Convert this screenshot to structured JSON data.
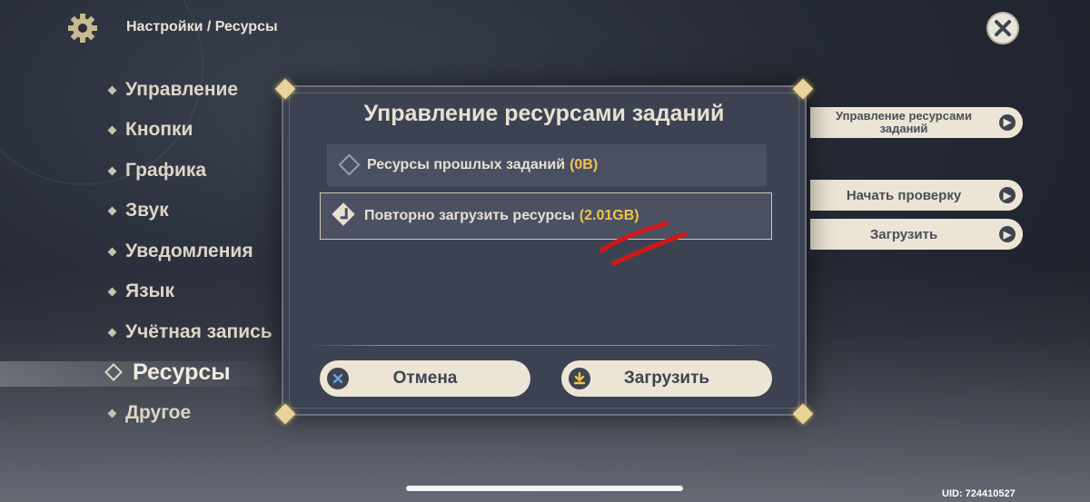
{
  "header": {
    "breadcrumb": "Настройки / Ресурсы",
    "settings_icon": "gear-icon",
    "close_icon": "close-icon"
  },
  "menu": {
    "items": [
      {
        "label": "Управление"
      },
      {
        "label": "Кнопки"
      },
      {
        "label": "Графика"
      },
      {
        "label": "Звук"
      },
      {
        "label": "Уведомления"
      },
      {
        "label": "Язык"
      },
      {
        "label": "Учётная запись"
      },
      {
        "label": "Ресурсы",
        "active": true
      },
      {
        "label": "Другое"
      }
    ]
  },
  "right_panel": {
    "manage_label": "Управление ресурсами заданий",
    "check_label": "Начать проверку",
    "download_label": "Загрузить"
  },
  "dialog": {
    "title": "Управление ресурсами заданий",
    "option_past": {
      "label": "Ресурсы прошлых заданий",
      "size": "(0B)",
      "selected": false
    },
    "option_reload": {
      "label": "Повторно загрузить ресурсы",
      "size": "(2.01GB)",
      "selected": true
    },
    "cancel_label": "Отмена",
    "confirm_label": "Загрузить"
  },
  "uid": "UID: 724410527",
  "colors": {
    "accent_gold": "#f0c44c",
    "button_bg": "#ece5d5",
    "dialog_bg": "#3c4252",
    "annotation_red": "#d01818"
  }
}
